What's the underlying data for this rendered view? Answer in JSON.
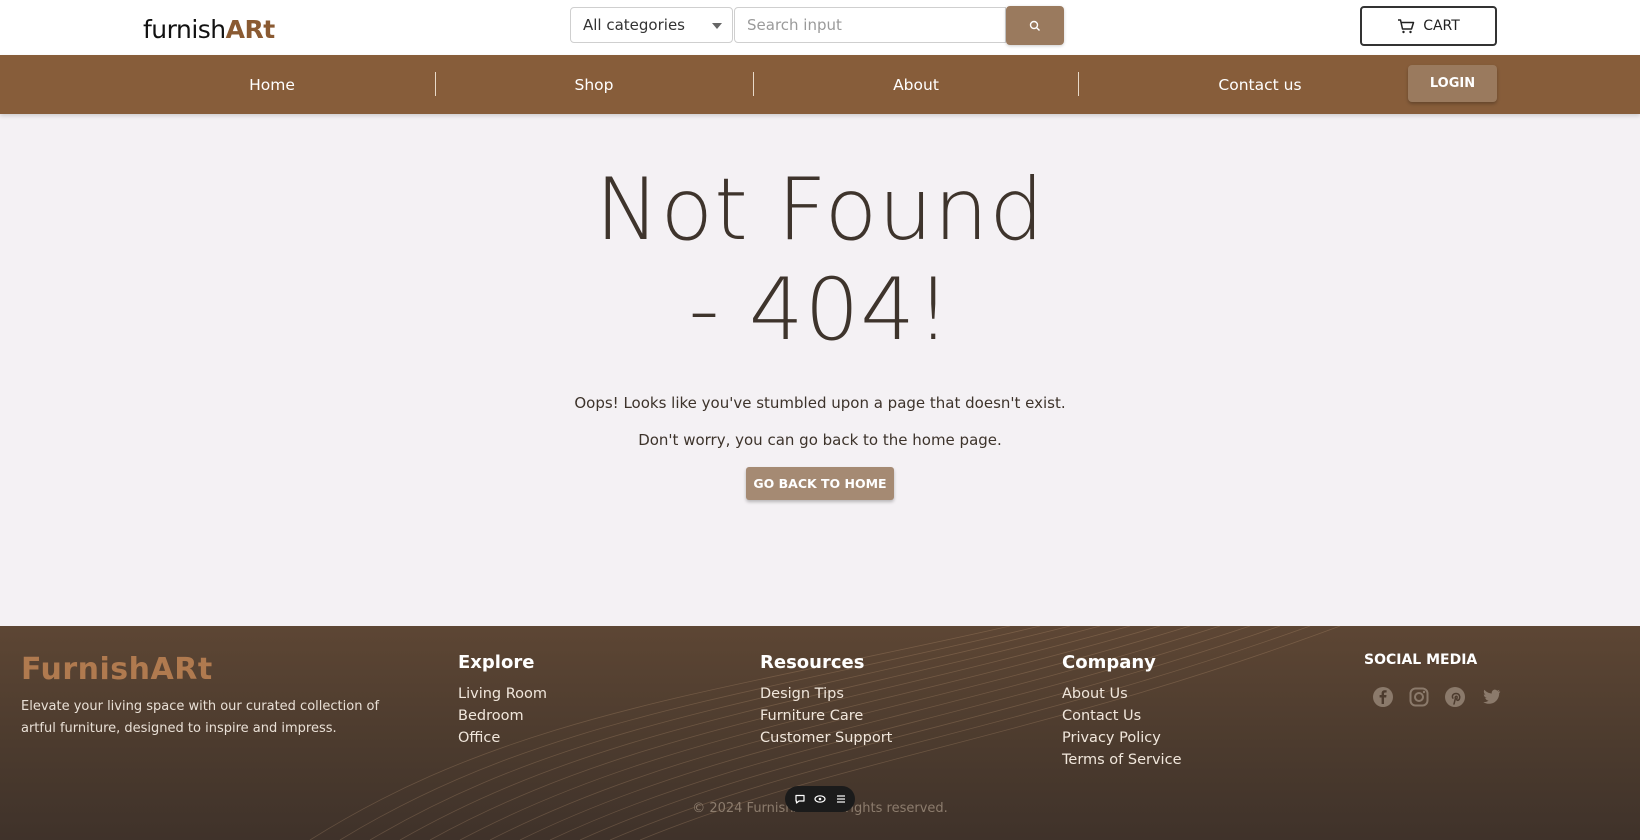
{
  "header": {
    "logo_text": "furnish",
    "logo_mark": "ARt",
    "category_select": "All categories",
    "search_placeholder": "Search input",
    "search_icon": "search-icon",
    "cart_label": "CART",
    "cart_icon": "cart-icon"
  },
  "nav": {
    "items": [
      "Home",
      "Shop",
      "About",
      "Contact us"
    ],
    "login_label": "LOGIN",
    "bar_color": "#875d3a"
  },
  "main": {
    "title_line1": "Not Found",
    "title_line2": "- 404!",
    "message1": "Oops! Looks like you've stumbled upon a page that doesn't exist.",
    "message2": "Don't worry, you can go back to the home page.",
    "home_button": "GO BACK TO HOME"
  },
  "footer": {
    "brand": "FurnishARt",
    "tagline": "Elevate your living space with our curated collection of artful furniture, designed to inspire and impress.",
    "columns": [
      {
        "title": "Explore",
        "links": [
          "Living Room",
          "Bedroom",
          "Office"
        ]
      },
      {
        "title": "Resources",
        "links": [
          "Design Tips",
          "Furniture Care",
          "Customer Support"
        ]
      },
      {
        "title": "Company",
        "links": [
          "About Us",
          "Contact Us",
          "Privacy Policy",
          "Terms of Service"
        ]
      }
    ],
    "social_title": "SOCIAL MEDIA",
    "social_icons": [
      "facebook-icon",
      "instagram-icon",
      "pinterest-icon",
      "twitter-icon"
    ],
    "copyright": "© 2024 FurnishARt. All rights reserved."
  },
  "floating_toolbar": {
    "icons": [
      "comment-icon",
      "eye-icon",
      "menu-icon"
    ]
  }
}
